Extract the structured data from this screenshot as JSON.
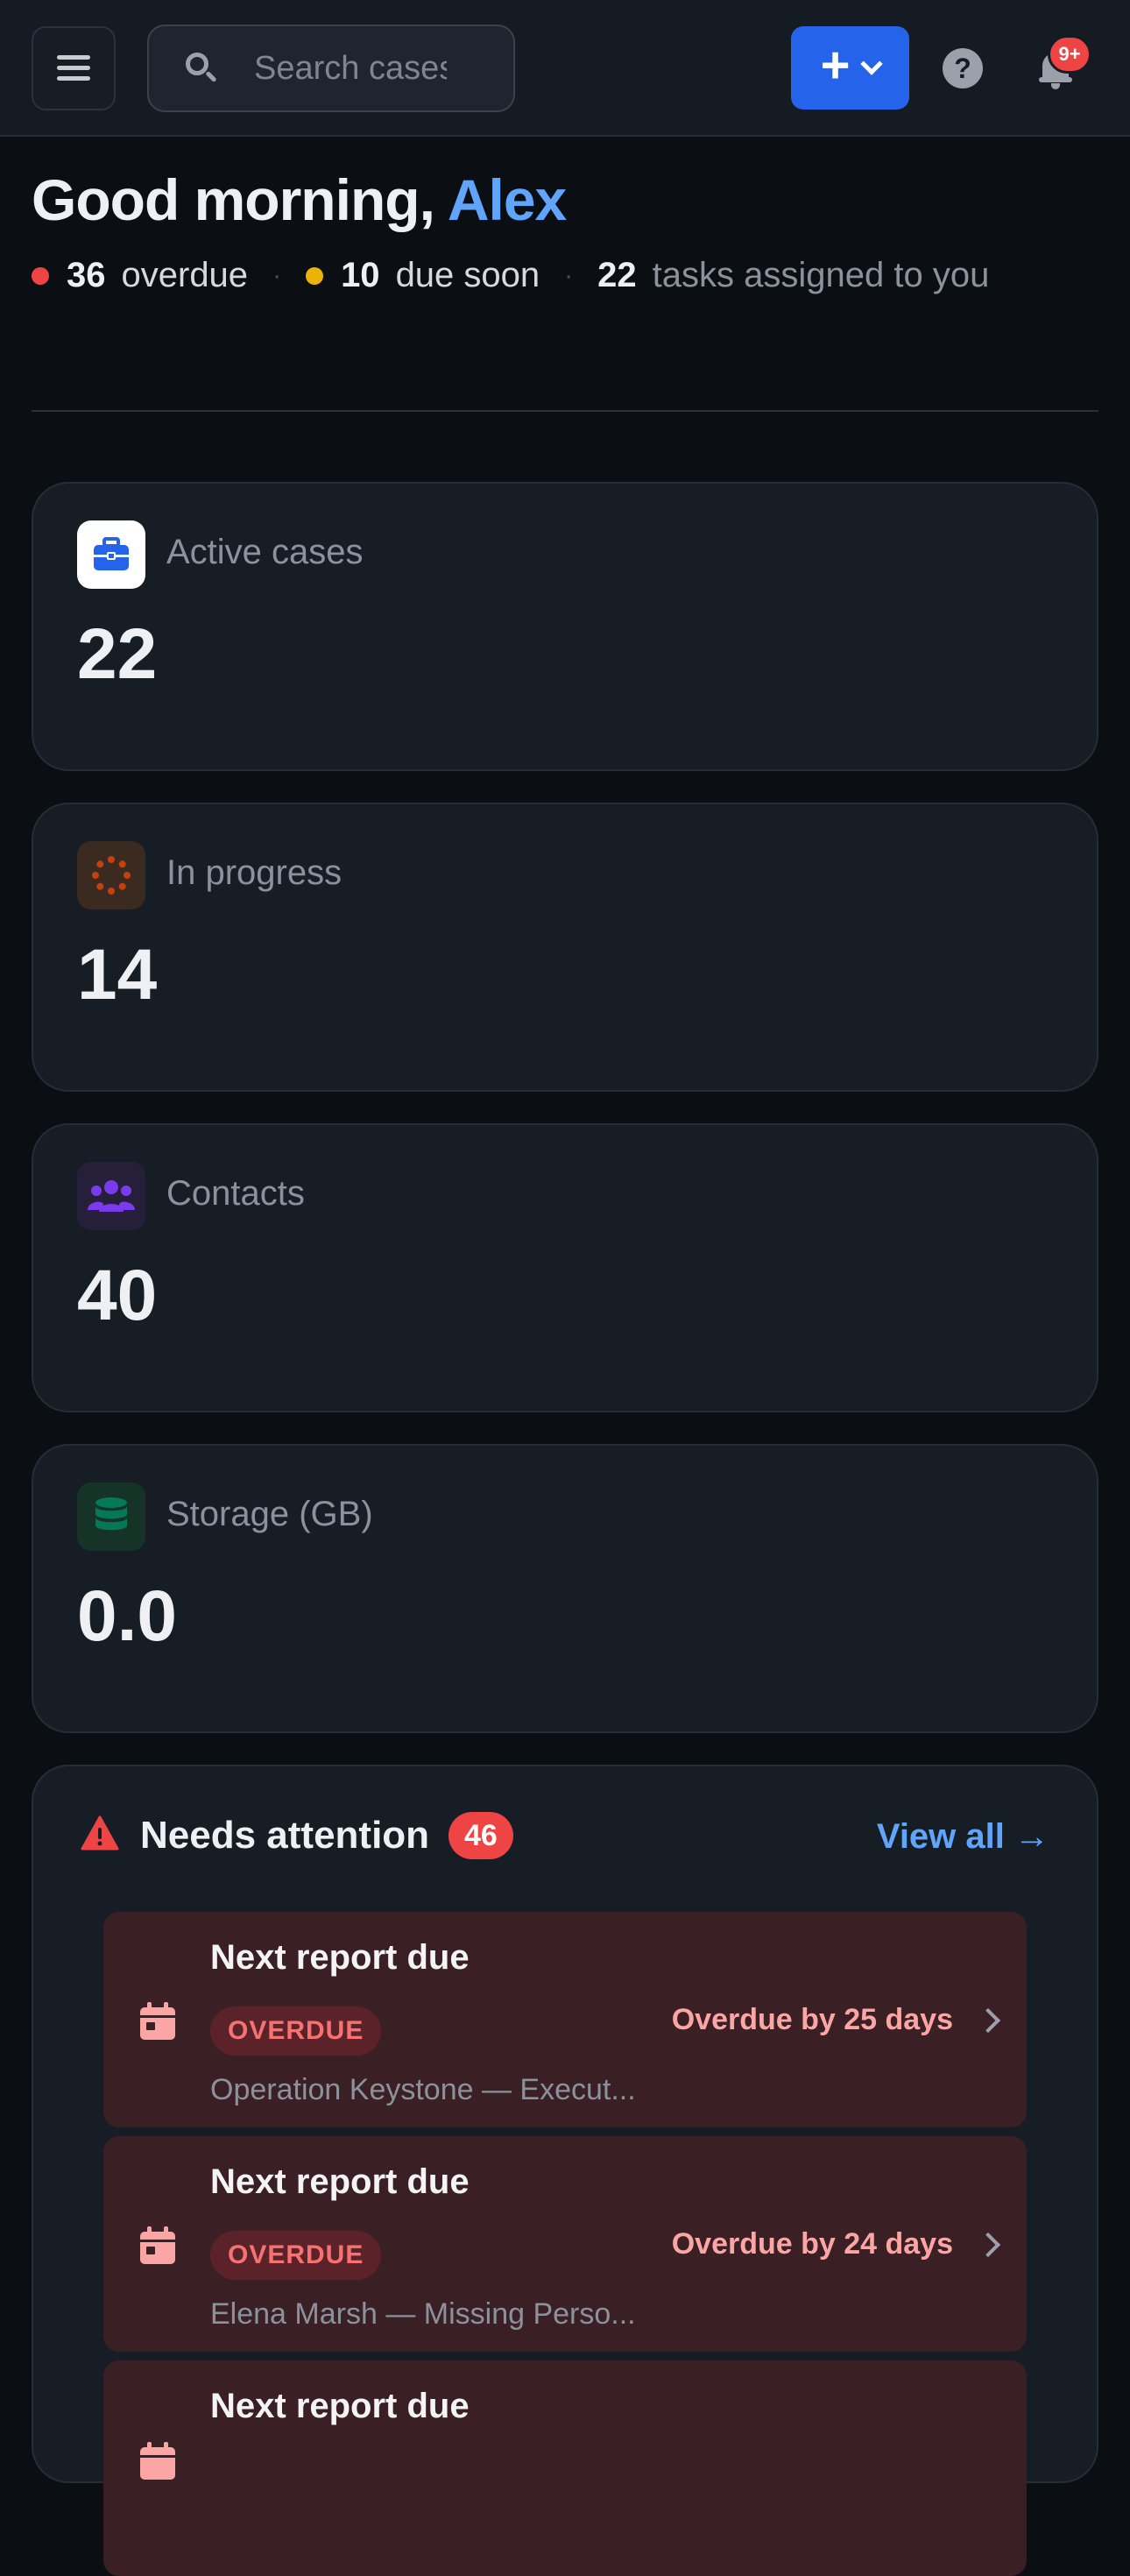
{
  "header": {
    "search_placeholder": "Search cases",
    "add_label": "+",
    "help_label": "?",
    "notifications_badge": "9+"
  },
  "greeting": {
    "prefix": "Good morning,",
    "name": "Alex"
  },
  "summary": {
    "overdue_count": "36",
    "overdue_label": "overdue",
    "due_soon_count": "10",
    "due_soon_label": "due soon",
    "tasks_count": "22",
    "tasks_label": "tasks assigned to you",
    "separator": "·"
  },
  "stats": [
    {
      "label": "Active cases",
      "value": "22",
      "icon": "briefcase-icon",
      "color": "#2563eb"
    },
    {
      "label": "In progress",
      "value": "14",
      "icon": "spinner-icon",
      "color": "#c2410c"
    },
    {
      "label": "Contacts",
      "value": "40",
      "icon": "users-icon",
      "color": "#7c3aed"
    },
    {
      "label": "Storage (GB)",
      "value": "0.0",
      "icon": "database-icon",
      "color": "#047857"
    }
  ],
  "attention": {
    "title": "Needs attention",
    "count": "46",
    "view_all": "View all →",
    "items": [
      {
        "title": "Next report due",
        "status": "OVERDUE",
        "subtitle": "Operation Keystone — Execut...",
        "due": "Overdue by 25 days"
      },
      {
        "title": "Next report due",
        "status": "OVERDUE",
        "subtitle": "Elena Marsh — Missing Perso...",
        "due": "Overdue by 24 days"
      },
      {
        "title": "Next report due",
        "status": "",
        "subtitle": "",
        "due": ""
      }
    ]
  },
  "colors": {
    "accent": "#2563eb",
    "link": "#60a5fa",
    "overdue": "#ef4444",
    "due_soon": "#eab308"
  }
}
